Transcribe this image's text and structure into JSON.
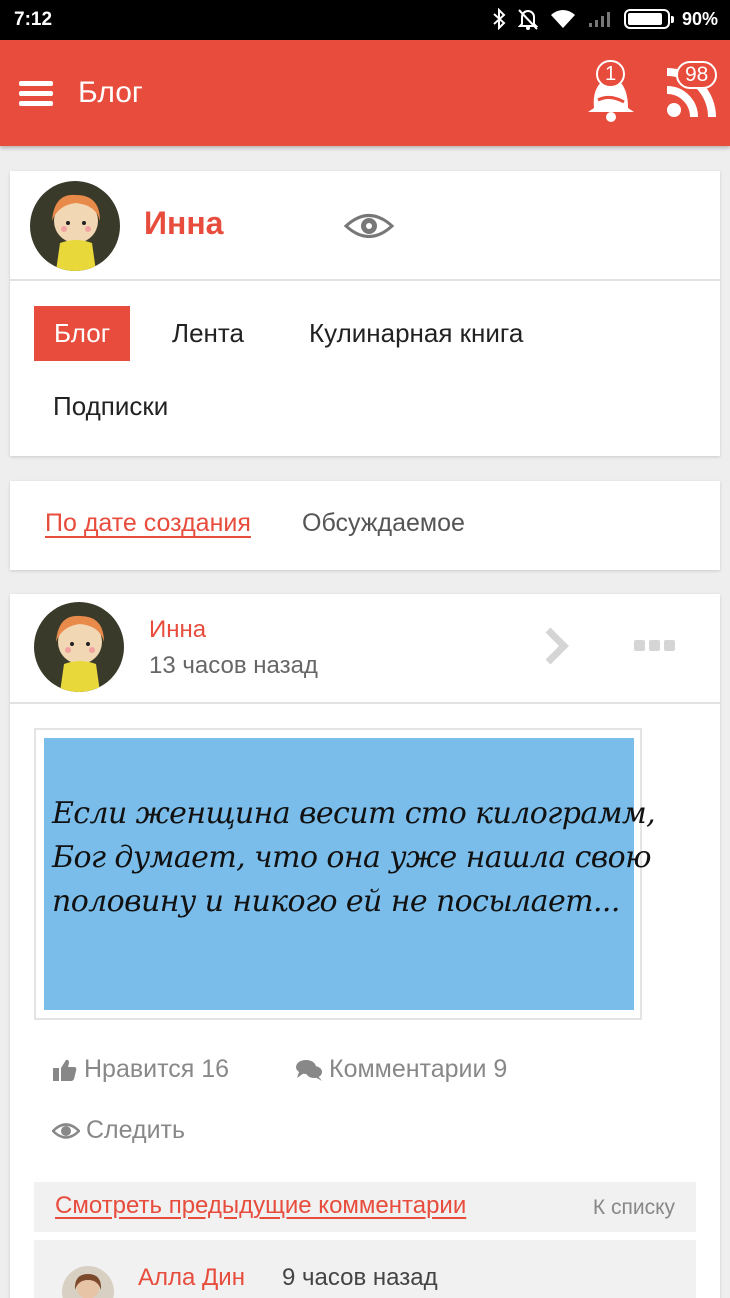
{
  "status": {
    "time": "7:12",
    "battery_text": "90%",
    "battery_level": 0.9
  },
  "appbar": {
    "title": "Блог",
    "notifications_count": "1",
    "feed_count": "98",
    "color": "#e74c3c"
  },
  "profile": {
    "name": "Инна"
  },
  "tabs": [
    {
      "label": "Блог",
      "active": true
    },
    {
      "label": "Лента",
      "active": false
    },
    {
      "label": "Кулинарная книга",
      "active": false
    },
    {
      "label": "Подписки",
      "active": false
    }
  ],
  "sort": {
    "by_date": "По дате создания",
    "discussed": "Обсуждаемое"
  },
  "post": {
    "author": "Инна",
    "time": "13 часов назад",
    "image_text": "Если женщина весит сто килограмм,\nБог думает, что она уже нашла свою\nполовину и никого ей не посылает...",
    "image_bg": "#7abdea",
    "likes_label": "Нравится 16",
    "comments_label": "Комментарии 9",
    "follow_label": "Следить"
  },
  "comments": {
    "prev_label": "Смотреть предыдущие комментарии",
    "to_list_label": "К списку",
    "items": [
      {
        "author": "Алла Дин",
        "time": "9 часов назад"
      }
    ]
  }
}
